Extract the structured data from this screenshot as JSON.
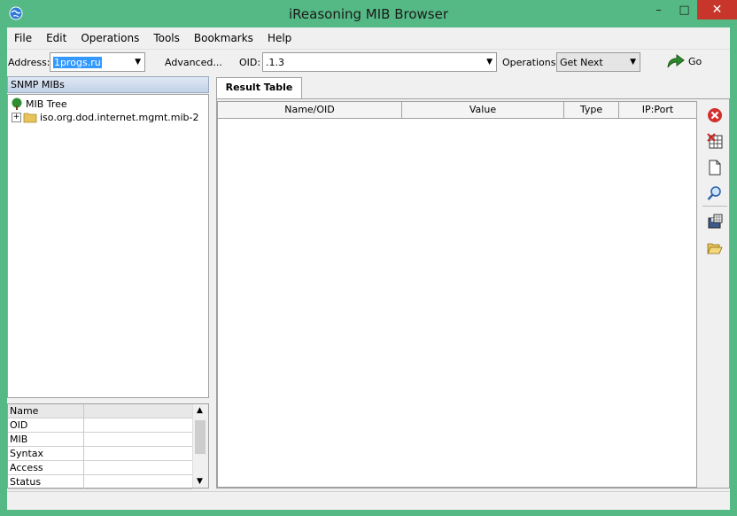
{
  "window": {
    "title": "iReasoning MIB Browser",
    "min": "–",
    "max": "□",
    "close": "✕"
  },
  "menu": [
    "File",
    "Edit",
    "Operations",
    "Tools",
    "Bookmarks",
    "Help"
  ],
  "toolbar": {
    "address_label": "Address:",
    "address_value": "1progs.ru",
    "advanced_label": "Advanced...",
    "oid_label": "OID:",
    "oid_value": ".1.3",
    "operations_label": "Operations:",
    "operations_value": "Get Next",
    "go_label": "Go"
  },
  "left": {
    "header": "SNMP MIBs",
    "tree_root": "MIB Tree",
    "tree_child": "iso.org.dod.internet.mgmt.mib-2",
    "props": [
      "Name",
      "OID",
      "MIB",
      "Syntax",
      "Access",
      "Status"
    ]
  },
  "right": {
    "tab": "Result Table",
    "columns": [
      "Name/OID",
      "Value",
      "Type",
      "IP:Port"
    ]
  },
  "icons": [
    "delete-red-icon",
    "delete-table-icon",
    "new-document-icon",
    "search-icon",
    "save-table-icon",
    "open-folder-icon"
  ]
}
